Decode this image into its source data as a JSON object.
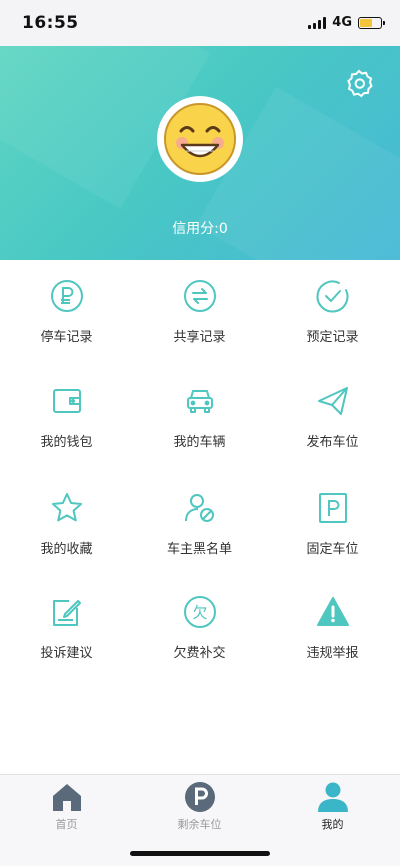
{
  "status": {
    "time": "16:55",
    "network": "4G"
  },
  "profile": {
    "credit_label": "信用分:0"
  },
  "menu": [
    {
      "label": "停车记录",
      "icon": "parking-coin-icon"
    },
    {
      "label": "共享记录",
      "icon": "share-arrows-icon"
    },
    {
      "label": "预定记录",
      "icon": "reservation-check-icon"
    },
    {
      "label": "我的钱包",
      "icon": "wallet-icon"
    },
    {
      "label": "我的车辆",
      "icon": "car-icon"
    },
    {
      "label": "发布车位",
      "icon": "paper-plane-icon"
    },
    {
      "label": "我的收藏",
      "icon": "star-icon"
    },
    {
      "label": "车主黑名单",
      "icon": "user-block-icon"
    },
    {
      "label": "固定车位",
      "icon": "parking-sign-icon"
    },
    {
      "label": "投诉建议",
      "icon": "edit-note-icon"
    },
    {
      "label": "欠费补交",
      "icon": "arrears-icon"
    },
    {
      "label": "违规举报",
      "icon": "warning-icon"
    }
  ],
  "arrears_glyph": "欠",
  "tabs": [
    {
      "label": "首页",
      "icon": "home-icon"
    },
    {
      "label": "剩余车位",
      "icon": "parking-icon"
    },
    {
      "label": "我的",
      "icon": "user-icon"
    }
  ],
  "colors": {
    "accent": "#4fc6bf",
    "header_start": "#5fd6c2",
    "header_end": "#46b8d6",
    "tab_inactive": "#5a6a7a",
    "tab_active": "#3bb5c8"
  }
}
